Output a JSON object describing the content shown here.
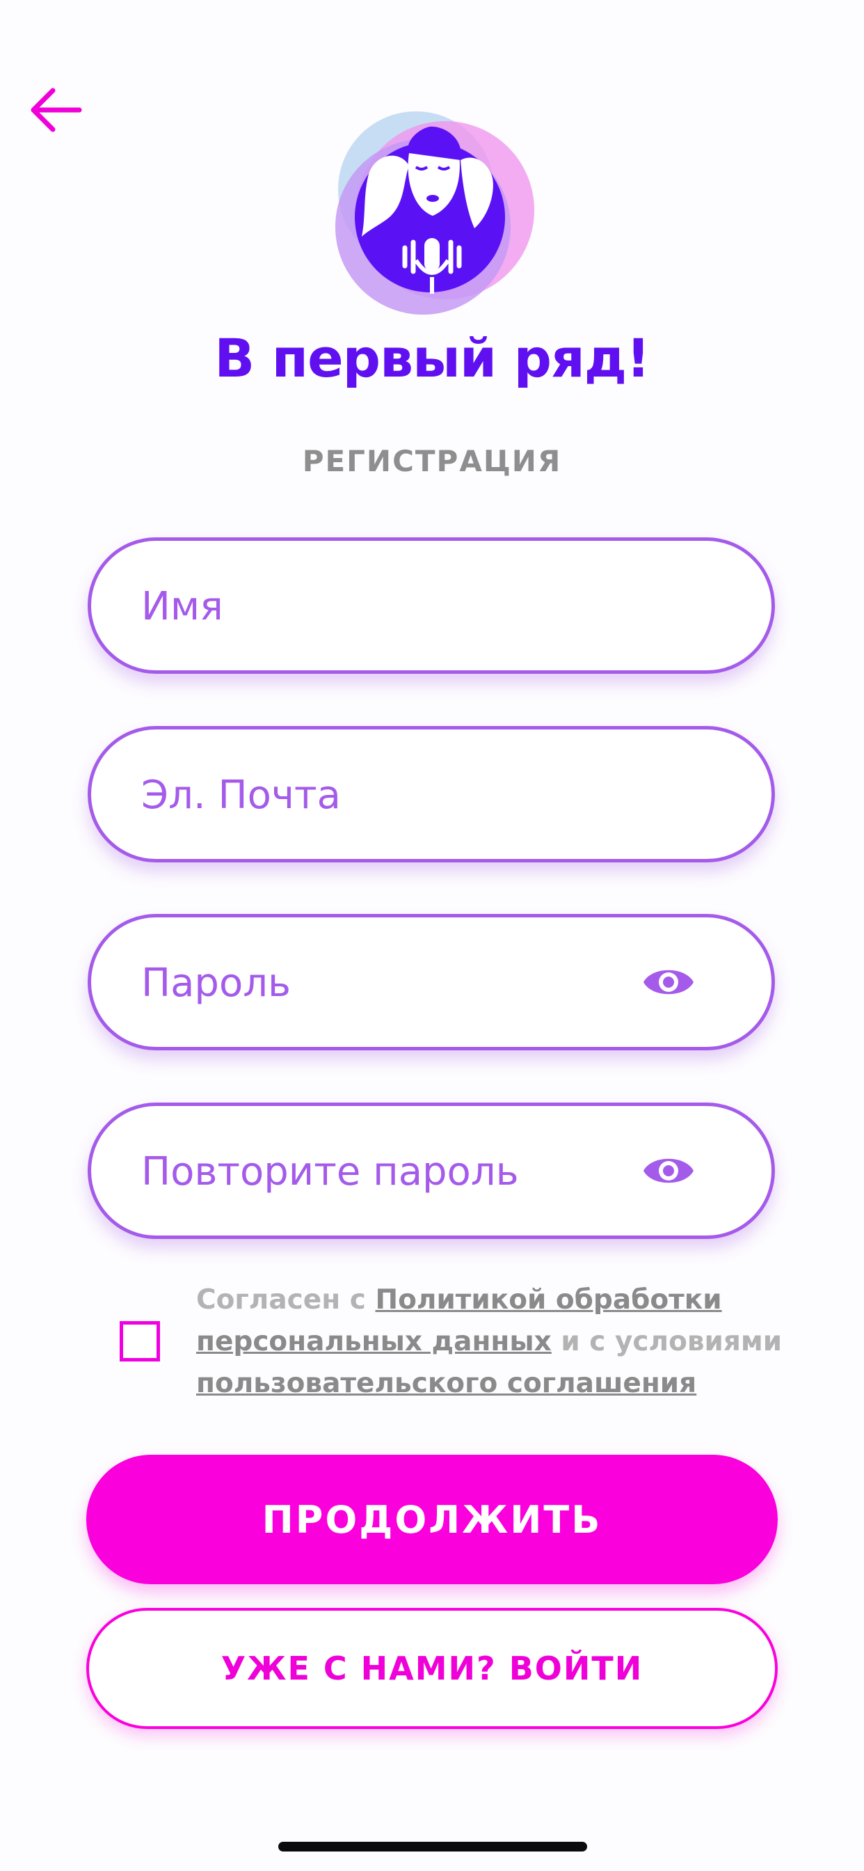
{
  "header": {
    "back_icon": "arrow-left-icon",
    "accent_color": "#fa00dc"
  },
  "brand": {
    "logo_icon": "singers-microphone-logo",
    "app_name": "В первый ряд!",
    "brand_color": "#6010f0"
  },
  "screen": {
    "title": "РЕГИСТРАЦИЯ"
  },
  "form": {
    "name": {
      "placeholder": "Имя",
      "value": ""
    },
    "email": {
      "placeholder": "Эл. Почта",
      "value": ""
    },
    "password": {
      "placeholder": "Пароль",
      "value": "",
      "toggle_icon": "eye-icon"
    },
    "password_repeat": {
      "placeholder": "Повторите пароль",
      "value": "",
      "toggle_icon": "eye-icon"
    },
    "field_border_color": "#a45bea"
  },
  "consent": {
    "checked": false,
    "text_1": "Согласен с ",
    "link_policy": "Политикой обработки персональных данных",
    "text_2": " и с условиями ",
    "link_terms": "пользовательского соглашения"
  },
  "actions": {
    "continue_label": "ПРОДОЛЖИТЬ",
    "login_label": "УЖЕ С НАМИ? ВОЙТИ"
  }
}
